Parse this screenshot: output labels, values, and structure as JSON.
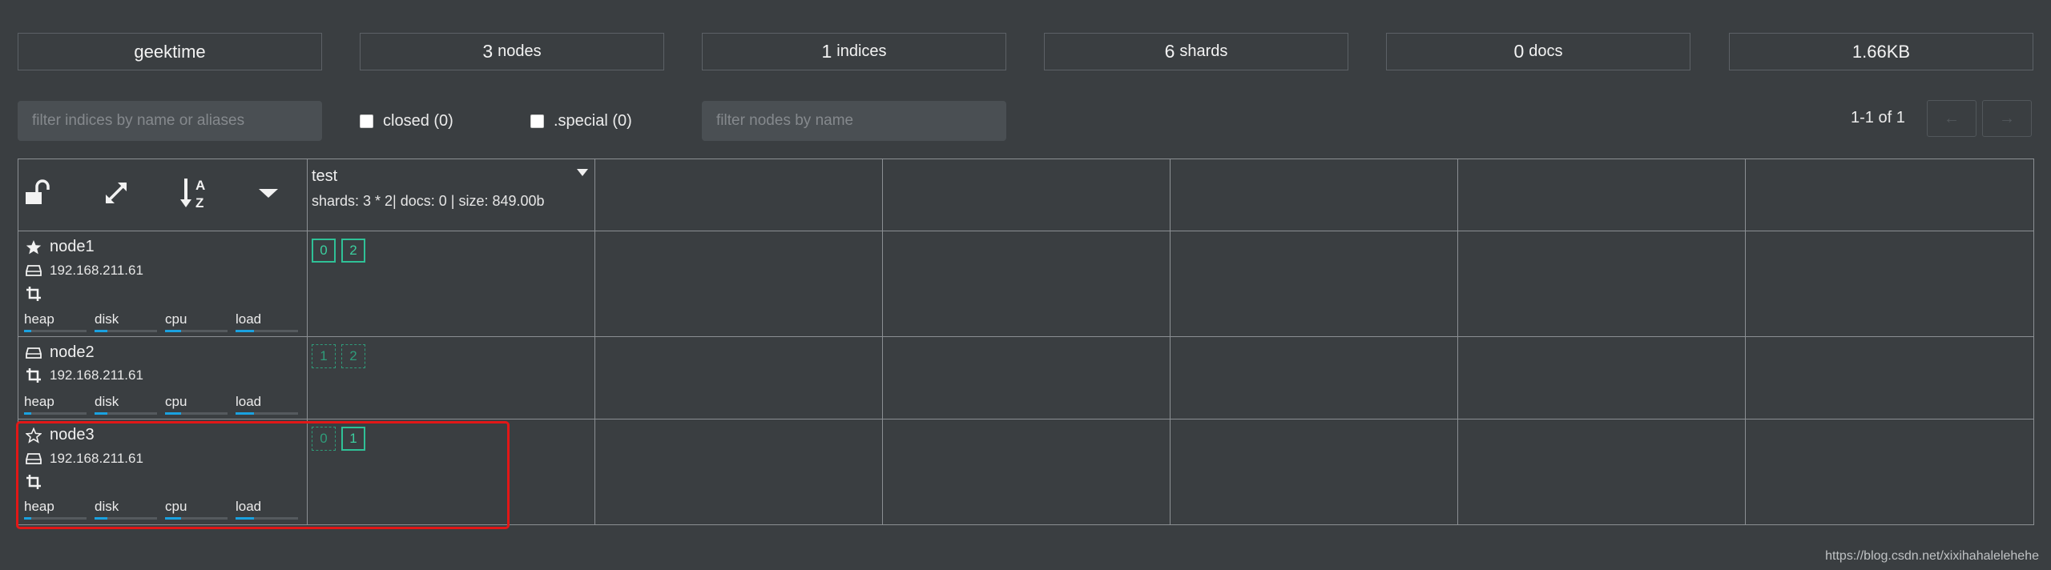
{
  "stats": [
    {
      "num": "geektime",
      "unit": ""
    },
    {
      "num": "3",
      "unit": "nodes"
    },
    {
      "num": "1",
      "unit": "indices"
    },
    {
      "num": "6",
      "unit": "shards"
    },
    {
      "num": "0",
      "unit": "docs"
    },
    {
      "num": "1.66KB",
      "unit": ""
    }
  ],
  "filters": {
    "indices_placeholder": "filter indices by name or aliases",
    "closed_label": "closed (0)",
    "special_label": ".special (0)",
    "nodes_placeholder": "filter nodes by name"
  },
  "pager": {
    "text": "1-1 of 1",
    "prev": "←",
    "next": "→"
  },
  "index": {
    "name": "test",
    "info": "shards: 3 * 2| docs: 0 | size: 849.00b"
  },
  "metrics": [
    "heap",
    "disk",
    "cpu",
    "load"
  ],
  "nodes": [
    {
      "name": "node1",
      "ip": "192.168.211.61",
      "name_icon": "star-filled-icon",
      "ip_icon": "hard-drive-icon",
      "extra_icon": "crop-icon",
      "bars": [
        0.12,
        0.2,
        0.25,
        0.3
      ],
      "shards": [
        {
          "id": "0",
          "kind": "primary"
        },
        {
          "id": "2",
          "kind": "primary"
        }
      ]
    },
    {
      "name": "node2",
      "ip": "192.168.211.61",
      "name_icon": "hard-drive-icon",
      "ip_icon": "crop-icon",
      "bars": [
        0.12,
        0.2,
        0.25,
        0.3
      ],
      "shards": [
        {
          "id": "1",
          "kind": "replica"
        },
        {
          "id": "2",
          "kind": "replica"
        }
      ]
    },
    {
      "name": "node3",
      "ip": "192.168.211.61",
      "name_icon": "star-outline-icon",
      "ip_icon": "hard-drive-icon",
      "extra_icon": "crop-icon",
      "bars": [
        0.12,
        0.2,
        0.25,
        0.3
      ],
      "shards": [
        {
          "id": "0",
          "kind": "replica"
        },
        {
          "id": "1",
          "kind": "primary"
        }
      ]
    }
  ],
  "watermark": "https://blog.csdn.net/xixihahalelehehe",
  "colors": {
    "background": "#3a3e41",
    "shard": "#2fc197",
    "bar": "#1aa2e0",
    "highlight": "#e21717"
  }
}
